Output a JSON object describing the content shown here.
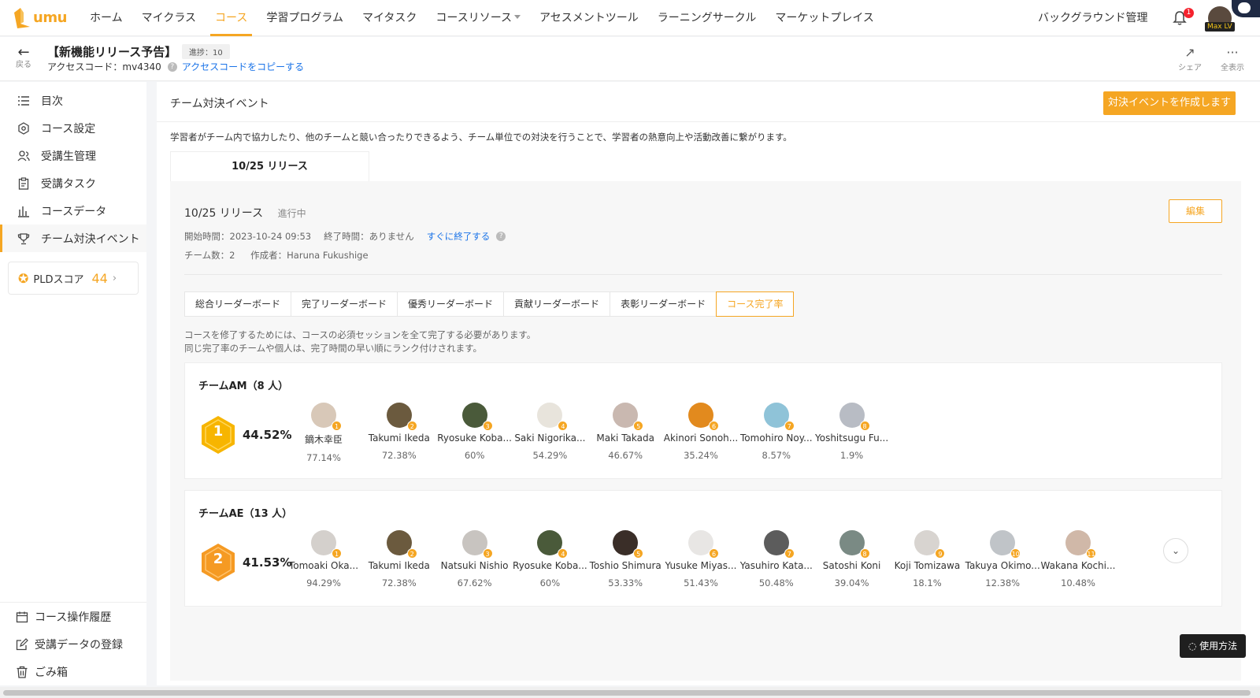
{
  "nav": {
    "logo_text": "umu",
    "items": [
      {
        "label": "ホーム",
        "active": false
      },
      {
        "label": "マイクラス",
        "active": false
      },
      {
        "label": "コース",
        "active": true
      },
      {
        "label": "学習プログラム",
        "active": false
      },
      {
        "label": "マイタスク",
        "active": false
      },
      {
        "label": "コースリソース",
        "active": false
      },
      {
        "label": "アセスメントツール",
        "active": false
      },
      {
        "label": "ラーニングサークル",
        "active": false
      },
      {
        "label": "マーケットプレイス",
        "active": false
      }
    ],
    "background_manage": "バックグラウンド管理",
    "notification_count": "1",
    "user_level": "Max LV"
  },
  "subheader": {
    "back_label": "戻る",
    "course_title": "【新機能リリース予告】",
    "progress_tag": "進捗：10",
    "access_code": "アクセスコード：mv4340",
    "copy_link": "アクセスコードをコピーする",
    "share_label": "シェア",
    "showall_label": "全表示"
  },
  "sidebar": {
    "items": [
      {
        "label": "目次",
        "icon": "list-icon"
      },
      {
        "label": "コース設定",
        "icon": "settings-icon"
      },
      {
        "label": "受講生管理",
        "icon": "users-icon"
      },
      {
        "label": "受講タスク",
        "icon": "clipboard-icon"
      },
      {
        "label": "コースデータ",
        "icon": "bar-chart-icon"
      },
      {
        "label": "チーム対決イベント",
        "icon": "trophy-icon"
      }
    ],
    "pld_label": "PLDスコア",
    "pld_score": "44",
    "bottom_items": [
      {
        "label": "コース操作履歴",
        "icon": "calendar-icon"
      },
      {
        "label": "受講データの登録",
        "icon": "edit-icon"
      },
      {
        "label": "ごみ箱",
        "icon": "trash-icon"
      }
    ]
  },
  "main": {
    "title": "チーム対決イベント",
    "create_button": "対決イベントを作成します",
    "description": "学習者がチーム内で協力したり、他のチームと競い合ったりできるよう、チーム単位での対決を行うことで、学習者の熱意向上や活動改善に繋がります。",
    "release_tab": "10/25 リリース",
    "release": {
      "name": "10/25 リリース",
      "status": "進行中",
      "edit_button": "編集",
      "start_time": "開始時間：2023-10-24 09:53",
      "end_time": "終了時間：ありません",
      "end_now_link": "すぐに終了する",
      "team_count": "チーム数：2",
      "creator": "作成者：Haruna Fukushige"
    },
    "leaderboard_tabs": [
      {
        "label": "総合リーダーボード",
        "active": false
      },
      {
        "label": "完了リーダーボード",
        "active": false
      },
      {
        "label": "優秀リーダーボード",
        "active": false
      },
      {
        "label": "貢献リーダーボード",
        "active": false
      },
      {
        "label": "表彰リーダーボード",
        "active": false
      },
      {
        "label": "コース完了率",
        "active": true
      }
    ],
    "note1": "コースを修了するためには、コースの必須セッションを全て完了する必要があります。",
    "note2": "同じ完了率のチームや個人は、完了時間の早い順にランク付けされます。",
    "teams": [
      {
        "name": "チームAM（8 人）",
        "rank": "1",
        "rate": "44.52%",
        "badge_color": "#f7b500",
        "members": [
          {
            "rank": "1",
            "name": "鏑木幸臣",
            "rate": "77.14%",
            "color": "#d8c8b8"
          },
          {
            "rank": "2",
            "name": "Takumi Ikeda",
            "rate": "72.38%",
            "color": "#6b5a3e"
          },
          {
            "rank": "3",
            "name": "Ryosuke Koba...",
            "rate": "60%",
            "color": "#4a5a3a"
          },
          {
            "rank": "4",
            "name": "Saki Nigorika...",
            "rate": "54.29%",
            "color": "#e8e4dc"
          },
          {
            "rank": "5",
            "name": "Maki Takada",
            "rate": "46.67%",
            "color": "#c9b8b0"
          },
          {
            "rank": "6",
            "name": "Akinori Sonoh...",
            "rate": "35.24%",
            "color": "#e28a1e"
          },
          {
            "rank": "7",
            "name": "Tomohiro Noy...",
            "rate": "8.57%",
            "color": "#8fc3d8"
          },
          {
            "rank": "8",
            "name": "Yoshitsugu Fu...",
            "rate": "1.9%",
            "color": "#b8bcc4"
          }
        ]
      },
      {
        "name": "チームAE（13 人）",
        "rank": "2",
        "rate": "41.53%",
        "badge_color": "#f59a23",
        "members": [
          {
            "rank": "1",
            "name": "Tomoaki Oka...",
            "rate": "94.29%",
            "color": "#d4d0cc"
          },
          {
            "rank": "2",
            "name": "Takumi Ikeda",
            "rate": "72.38%",
            "color": "#6b5a3e"
          },
          {
            "rank": "3",
            "name": "Natsuki Nishio",
            "rate": "67.62%",
            "color": "#c8c4c0"
          },
          {
            "rank": "4",
            "name": "Ryosuke Koba...",
            "rate": "60%",
            "color": "#4a5a3a"
          },
          {
            "rank": "5",
            "name": "Toshio Shimura",
            "rate": "53.33%",
            "color": "#3a2e28"
          },
          {
            "rank": "6",
            "name": "Yusuke Miyas...",
            "rate": "51.43%",
            "color": "#e8e6e4"
          },
          {
            "rank": "7",
            "name": "Yasuhiro Kata...",
            "rate": "50.48%",
            "color": "#5c5c5c"
          },
          {
            "rank": "8",
            "name": "Satoshi Koni",
            "rate": "39.04%",
            "color": "#7a8a84"
          },
          {
            "rank": "9",
            "name": "Koji Tomizawa",
            "rate": "18.1%",
            "color": "#d8d4d0"
          },
          {
            "rank": "10",
            "name": "Takuya Okimo...",
            "rate": "12.38%",
            "color": "#c0c4c8"
          },
          {
            "rank": "11",
            "name": "Wakana Kochi...",
            "rate": "10.48%",
            "color": "#d0b8a8"
          }
        ]
      }
    ]
  },
  "help_button": "使用方法",
  "colors": {
    "accent": "#f5a623",
    "link": "#1a73e8"
  }
}
